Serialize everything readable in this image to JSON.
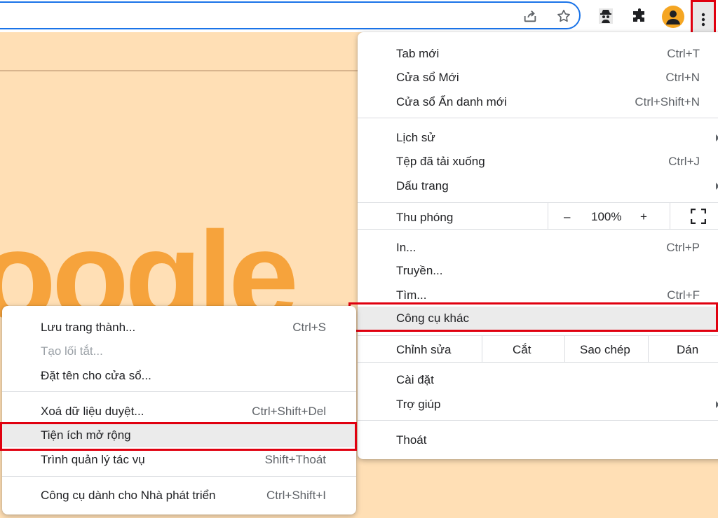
{
  "toolbar": {
    "icons": [
      "share-icon",
      "star-icon",
      "incognito-extension-icon",
      "puzzle-extensions-icon",
      "profile-avatar-icon",
      "kebab-menu-icon"
    ]
  },
  "page": {
    "logo_partial": "oogle"
  },
  "main_menu": {
    "new_tab": {
      "label": "Tab mới",
      "shortcut": "Ctrl+T"
    },
    "new_window": {
      "label": "Cửa sổ Mới",
      "shortcut": "Ctrl+N"
    },
    "incognito": {
      "label": "Cửa sổ Ẩn danh mới",
      "shortcut": "Ctrl+Shift+N"
    },
    "history": {
      "label": "Lịch sử"
    },
    "downloads": {
      "label": "Tệp đã tải xuống",
      "shortcut": "Ctrl+J"
    },
    "bookmarks": {
      "label": "Dấu trang"
    },
    "zoom": {
      "label": "Thu phóng",
      "minus": "–",
      "value": "100%",
      "plus": "+"
    },
    "print": {
      "label": "In...",
      "shortcut": "Ctrl+P"
    },
    "cast": {
      "label": "Truyền..."
    },
    "find": {
      "label": "Tìm...",
      "shortcut": "Ctrl+F"
    },
    "more_tools": {
      "label": "Công cụ khác"
    },
    "edit": {
      "label": "Chỉnh sửa",
      "cut": "Cắt",
      "copy": "Sao chép",
      "paste": "Dán"
    },
    "settings": {
      "label": "Cài đặt"
    },
    "help": {
      "label": "Trợ giúp"
    },
    "exit": {
      "label": "Thoát"
    }
  },
  "sub_menu": {
    "save_page": {
      "label": "Lưu trang thành...",
      "shortcut": "Ctrl+S"
    },
    "create_shortcut": {
      "label": "Tạo lối tắt..."
    },
    "name_window": {
      "label": "Đặt tên cho cửa sổ..."
    },
    "clear_data": {
      "label": "Xoá dữ liệu duyệt...",
      "shortcut": "Ctrl+Shift+Del"
    },
    "extensions": {
      "label": "Tiện ích mở rộng"
    },
    "task_manager": {
      "label": "Trình quản lý tác vụ",
      "shortcut": "Shift+Thoát"
    },
    "dev_tools": {
      "label": "Công cụ dành cho Nhà phát triển",
      "shortcut": "Ctrl+Shift+I"
    }
  },
  "colors": {
    "highlight_border": "#e0000f",
    "page_background": "#ffdfb5",
    "omnibox_border": "#1a73e8"
  }
}
